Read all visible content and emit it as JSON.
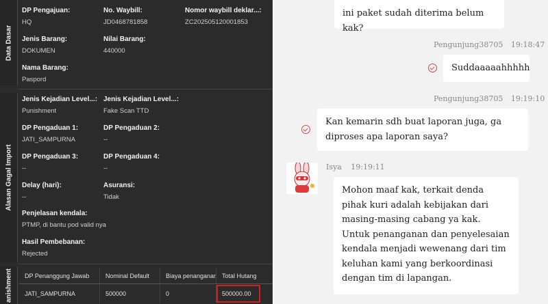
{
  "left_panel": {
    "tabs": {
      "data_dasar": "Data Dasar",
      "alasan_gagal": "Alasan Gagal Import",
      "punishment": "anishment"
    },
    "fields": {
      "dp_pengajuan": {
        "label": "DP Pengajuan:",
        "value": "HQ"
      },
      "no_waybill": {
        "label": "No. Waybill:",
        "value": "JD0468781858"
      },
      "nomor_waybill_deklar": {
        "label": "Nomor waybill deklar...:",
        "value": "ZC202505120001853"
      },
      "jenis_barang": {
        "label": "Jenis Barang:",
        "value": "DOKUMEN"
      },
      "nilai_barang": {
        "label": "Nilai Barang:",
        "value": "440000"
      },
      "nama_barang": {
        "label": "Nama Barang:",
        "value": "Paspord"
      },
      "jenis_kejadian_1": {
        "label": "Jenis Kejadian Level...:",
        "value": "Punishment"
      },
      "jenis_kejadian_2": {
        "label": "Jenis Kejadian Level...:",
        "value": "Fake Scan TTD"
      },
      "dp_pengaduan_1": {
        "label": "DP Pengaduan 1:",
        "value": "JATI_SAMPURNA"
      },
      "dp_pengaduan_2": {
        "label": "DP Pengaduan 2:",
        "value": "--"
      },
      "dp_pengaduan_3": {
        "label": "DP Pengaduan 3:",
        "value": "--"
      },
      "dp_pengaduan_4": {
        "label": "DP Pengaduan 4:",
        "value": "--"
      },
      "delay": {
        "label": "Delay (hari):",
        "value": "--"
      },
      "asuransi": {
        "label": "Asuransi:",
        "value": "Tidak"
      },
      "penjelasan": {
        "label": "Penjelasan kendala:",
        "value": "PTMP, di bantu pod valid nya"
      },
      "hasil": {
        "label": "Hasil Pembebanan:",
        "value": "Rejected"
      }
    },
    "table": {
      "headers": [
        "DP Penanggung Jawab",
        "Nominal Default",
        "Biaya penanganan",
        "Total Hutang"
      ],
      "row": [
        "JATI_SAMPURNA",
        "500000",
        "0",
        "500000.00"
      ]
    }
  },
  "chat": {
    "messages": [
      {
        "text": "ini paket sudah diterima belum kak?"
      },
      {
        "sender": "Pengunjung38705",
        "time": "19:18:47",
        "text": "Suddaaaaahhhhh"
      },
      {
        "sender": "Pengunjung38705",
        "time": "19:19:10",
        "text": "Kan kemarin sdh buat laporan juga, ga diproses apa laporan saya?"
      },
      {
        "sender": "Isya",
        "time": "19:19:11",
        "text": "Mohon maaf kak, terkait denda pihak kuri adalah kebijakan dari masing-masing cabang ya kak. Untuk penanganan dan penyelesaian kendala menjadi wewenang dari tim keluhan kami yang berkoordinasi dengan tim di lapangan."
      }
    ],
    "colors": {
      "check": "#c84a4a",
      "bubble": "#ffffff",
      "background": "#f2f2f2"
    }
  }
}
